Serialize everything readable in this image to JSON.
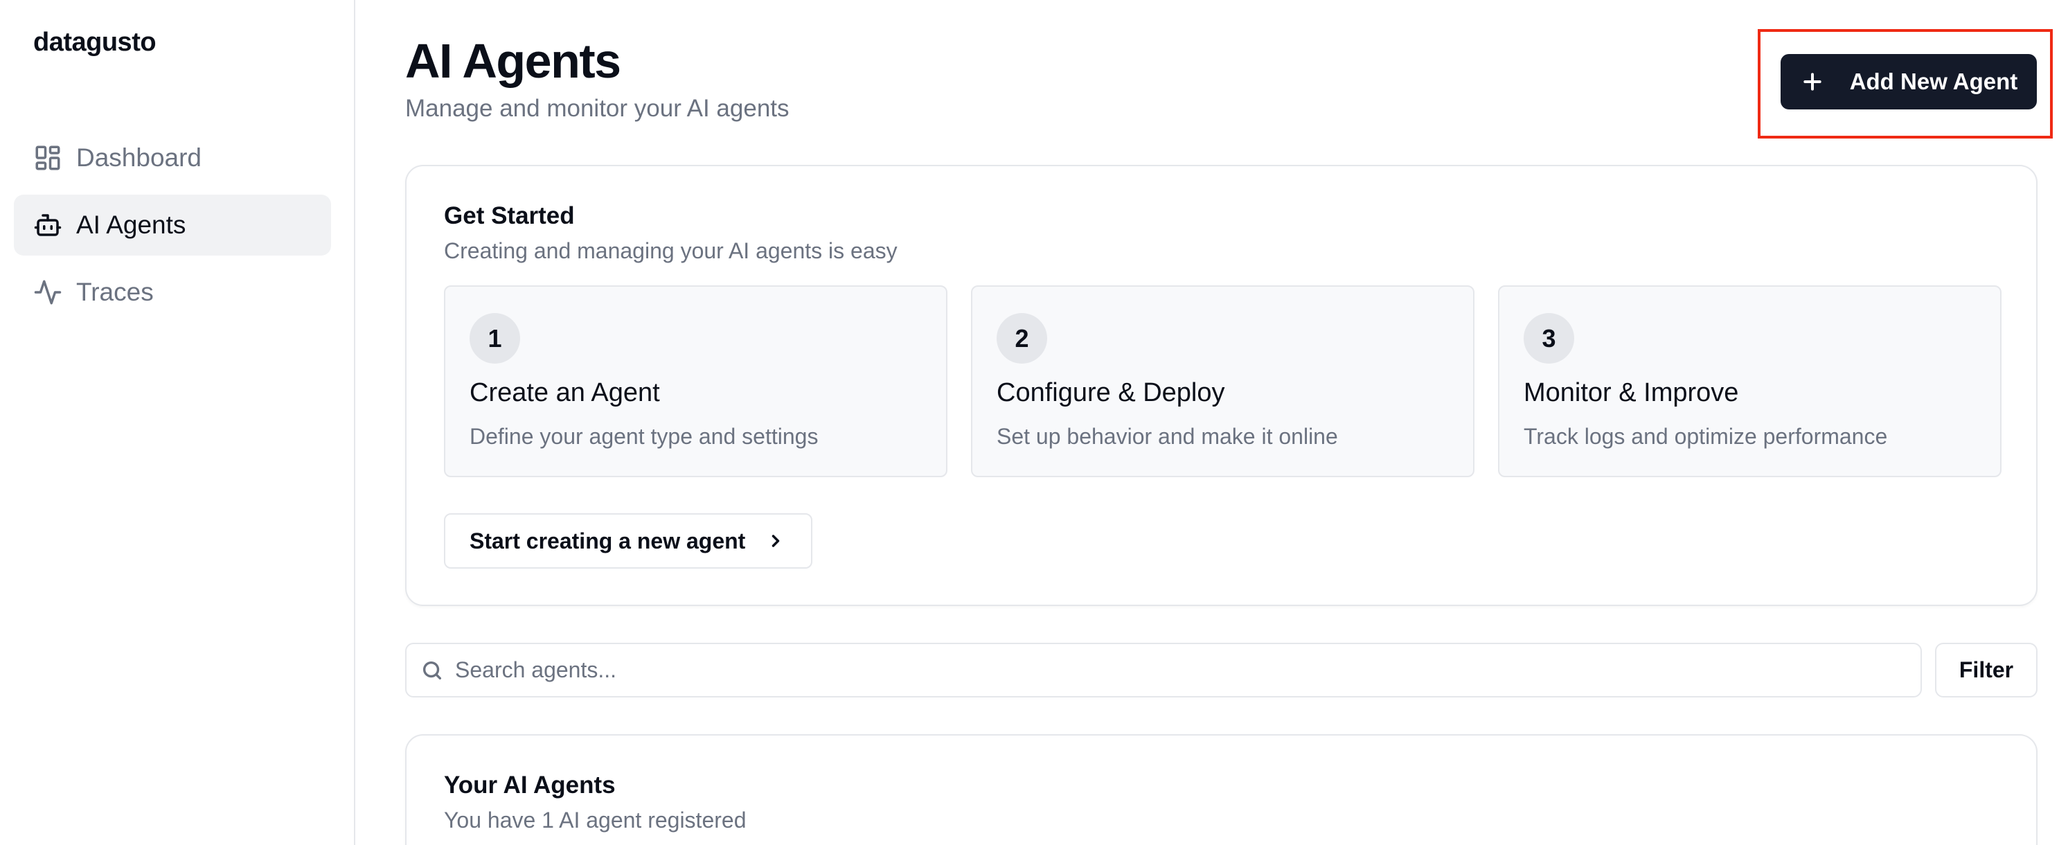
{
  "sidebar": {
    "logo": "datagusto",
    "items": [
      {
        "label": "Dashboard",
        "icon": "layout-grid-icon",
        "active": false
      },
      {
        "label": "AI Agents",
        "icon": "bot-icon",
        "active": true
      },
      {
        "label": "Traces",
        "icon": "activity-icon",
        "active": false
      }
    ]
  },
  "header": {
    "title": "AI Agents",
    "subtitle": "Manage and monitor your AI agents",
    "add_button_label": "Add New Agent",
    "add_button_icon": "plus-icon"
  },
  "get_started": {
    "title": "Get Started",
    "description": "Creating and managing your AI agents is easy",
    "steps": [
      {
        "number": "1",
        "title": "Create an Agent",
        "description": "Define your agent type and settings"
      },
      {
        "number": "2",
        "title": "Configure & Deploy",
        "description": "Set up behavior and make it online"
      },
      {
        "number": "3",
        "title": "Monitor & Improve",
        "description": "Track logs and optimize performance"
      }
    ],
    "cta_label": "Start creating a new agent",
    "cta_icon": "chevron-right-icon"
  },
  "search": {
    "placeholder": "Search agents...",
    "value": "",
    "icon": "search-icon",
    "filter_label": "Filter"
  },
  "agents": {
    "title": "Your AI Agents",
    "description": "You have 1 AI agent registered"
  },
  "colors": {
    "primary_button": "#141a29",
    "highlight": "#ef2a14",
    "muted_text": "#6b7280",
    "border": "#e5e7eb"
  }
}
